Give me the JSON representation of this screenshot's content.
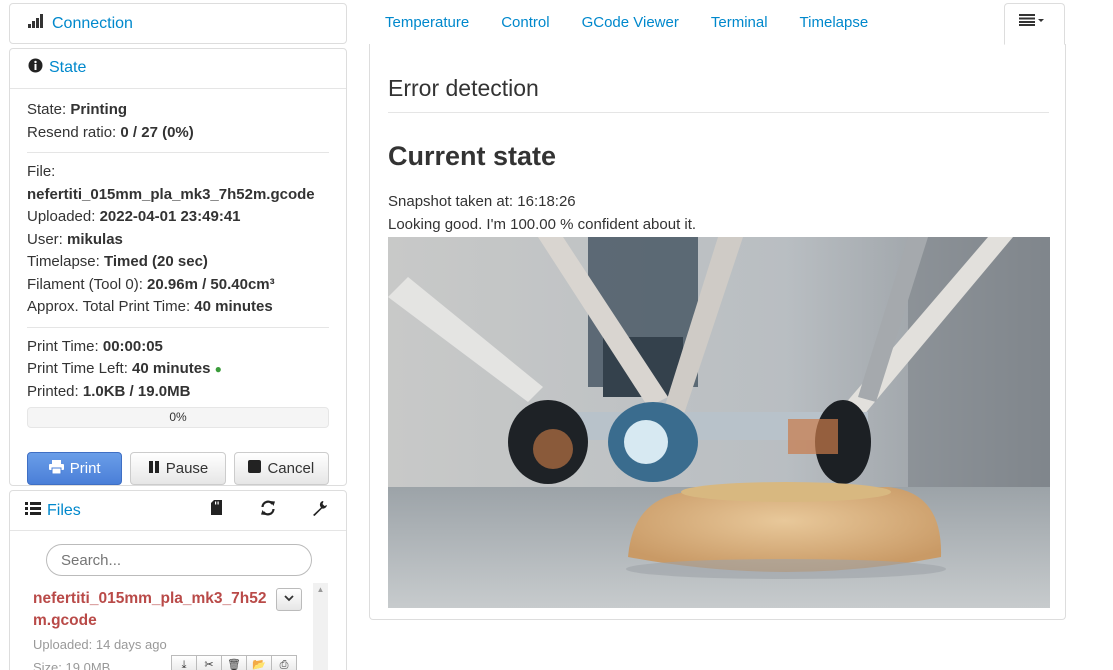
{
  "connection": {
    "label": "Connection",
    "icon": "signal-bars-icon"
  },
  "state_panel": {
    "label": "State",
    "icon": "info-circle-icon",
    "state_label": "State:",
    "state_value": "Printing",
    "resend_label": "Resend ratio:",
    "resend_value": "0 / 27 (0%)",
    "file_label": "File:",
    "file_value": "nefertiti_015mm_pla_mk3_7h52m.gcode",
    "uploaded_label": "Uploaded:",
    "uploaded_value": "2022-04-01 23:49:41",
    "user_label": "User:",
    "user_value": "mikulas",
    "timelapse_label": "Timelapse:",
    "timelapse_value": "Timed (20 sec)",
    "filament_label": "Filament (Tool 0):",
    "filament_value": "20.96m / 50.40cm³",
    "approx_label": "Approx. Total Print Time:",
    "approx_value": "40 minutes",
    "printtime_label": "Print Time:",
    "printtime_value": "00:00:05",
    "timeleft_label": "Print Time Left:",
    "timeleft_value": "40 minutes",
    "printed_label": "Printed:",
    "printed_value": "1.0KB / 19.0MB",
    "progress_text": "0%",
    "progress_fraction": 0,
    "buttons": {
      "print": "Print",
      "pause": "Pause",
      "cancel": "Cancel"
    },
    "accent_color": "#4a7fd8",
    "status_dot_color": "#3a9c3a"
  },
  "files_panel": {
    "label": "Files",
    "search_placeholder": "Search...",
    "file_name": "nefertiti_015mm_pla_mk3_7h52m.gcode",
    "file_uploaded": "Uploaded: 14 days ago",
    "file_size": "Size: 19.0MB",
    "name_color": "#b94a48"
  },
  "tabs": [
    "Temperature",
    "Control",
    "GCode Viewer",
    "Terminal",
    "Timelapse"
  ],
  "error_detection": {
    "title": "Error detection",
    "heading": "Current state",
    "snapshot_line": "Snapshot taken at: 16:18:26",
    "confidence_line": "Looking good. I'm 100.00 % confident about it."
  }
}
